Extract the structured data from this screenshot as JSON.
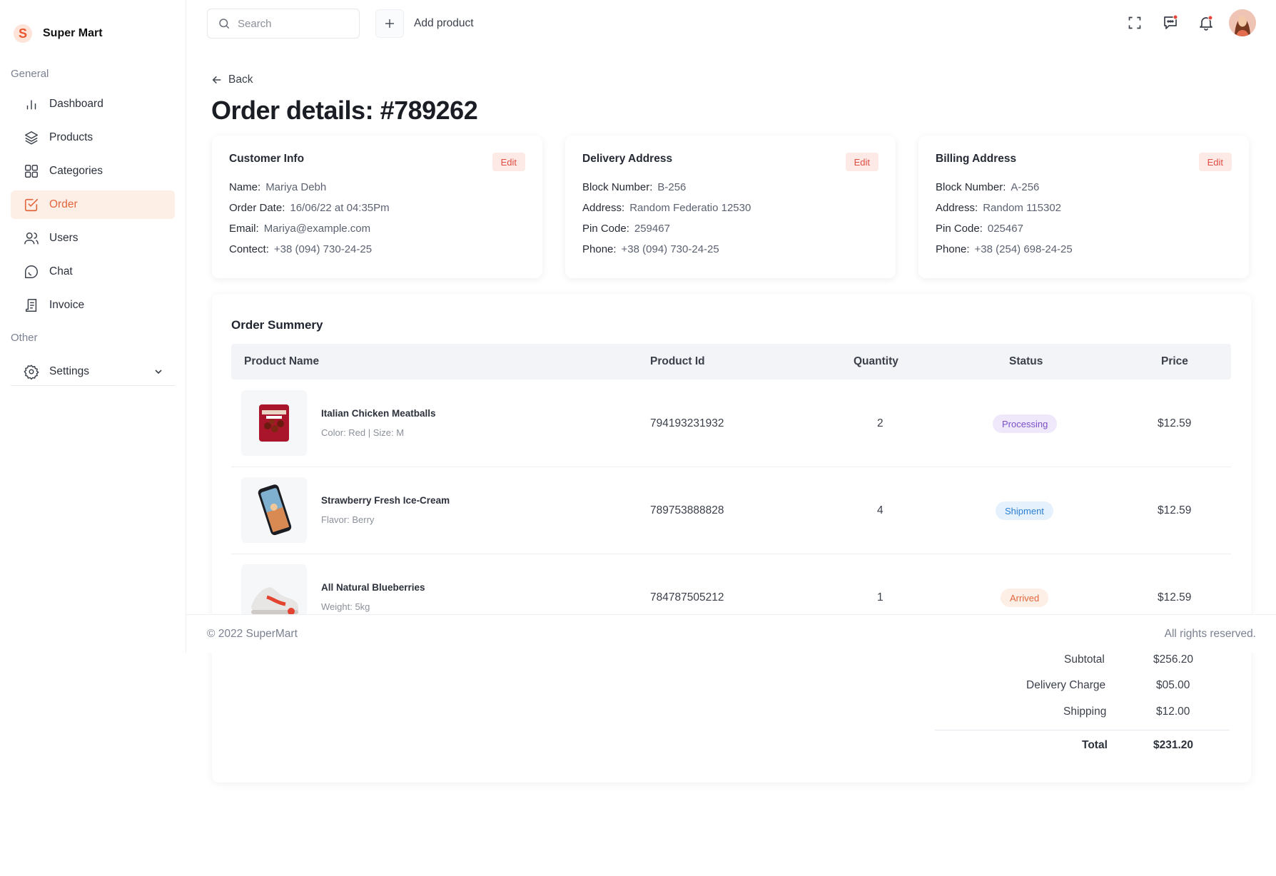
{
  "app": {
    "name": "Super Mart",
    "logo_letter": "S",
    "accent": "#e2673d"
  },
  "sidebar": {
    "sections": [
      {
        "label": "General"
      },
      {
        "label": "Other"
      }
    ],
    "items": [
      {
        "label": "Dashboard",
        "icon": "bar-chart-icon"
      },
      {
        "label": "Products",
        "icon": "layers-icon"
      },
      {
        "label": "Categories",
        "icon": "grid-icon"
      },
      {
        "label": "Order",
        "icon": "checkbox-icon",
        "active": true
      },
      {
        "label": "Users",
        "icon": "users-icon"
      },
      {
        "label": "Chat",
        "icon": "chat-icon"
      },
      {
        "label": "Invoice",
        "icon": "receipt-icon"
      },
      {
        "label": "Settings",
        "icon": "gear-icon"
      }
    ]
  },
  "topbar": {
    "search_placeholder": "Search",
    "add_product_label": "Add product"
  },
  "page": {
    "back_label": "Back",
    "title": "Order details: #789262"
  },
  "cards": [
    {
      "title": "Customer Info",
      "edit_label": "Edit",
      "rows": [
        {
          "k": "Name:",
          "v": "Mariya Debh"
        },
        {
          "k": "Order Date:",
          "v": "16/06/22 at 04:35Pm"
        },
        {
          "k": "Email:",
          "v": "Mariya@example.com"
        },
        {
          "k": "Contect:",
          "v": "+38 (094) 730-24-25"
        }
      ]
    },
    {
      "title": "Delivery Address",
      "edit_label": "Edit",
      "rows": [
        {
          "k": "Block Number:",
          "v": "B-256"
        },
        {
          "k": "Address:",
          "v": "Random Federatio 12530"
        },
        {
          "k": "Pin Code:",
          "v": "259467"
        },
        {
          "k": "Phone:",
          "v": "+38 (094) 730-24-25"
        }
      ]
    },
    {
      "title": "Billing Address",
      "edit_label": "Edit",
      "rows": [
        {
          "k": "Block Number:",
          "v": "A-256"
        },
        {
          "k": "Address:",
          "v": "Random 115302"
        },
        {
          "k": "Pin Code:",
          "v": "025467"
        },
        {
          "k": "Phone:",
          "v": "+38 (254) 698-24-25"
        }
      ]
    }
  ],
  "summary": {
    "title": "Order Summery",
    "columns": [
      "Product Name",
      "Product Id",
      "Quantity",
      "Status",
      "Price"
    ],
    "rows": [
      {
        "name": "Italian Chicken Meatballs",
        "meta": "Color: Red | Size: M",
        "id": "794193231932",
        "qty": "2",
        "status": "Processing",
        "price": "$12.59",
        "thumb": "meatballs-package"
      },
      {
        "name": "Strawberry Fresh Ice-Cream",
        "meta": "Flavor: Berry",
        "id": "789753888828",
        "qty": "4",
        "status": "Shipment",
        "price": "$12.59",
        "thumb": "smartphone"
      },
      {
        "name": "All Natural Blueberries",
        "meta": "Weight: 5kg",
        "id": "784787505212",
        "qty": "1",
        "status": "Arrived",
        "price": "$12.59",
        "thumb": "sneaker"
      }
    ],
    "status_colors": {
      "Processing": "#7a4fc7",
      "Shipment": "#2a7fd4",
      "Arrived": "#e2673d"
    },
    "totals": [
      {
        "label": "Subtotal",
        "value": "$256.20"
      },
      {
        "label": "Delivery Charge",
        "value": "$05.00"
      },
      {
        "label": "Shipping",
        "value": "$12.00"
      },
      {
        "label": "Total",
        "value": "$231.20"
      }
    ]
  },
  "footer": {
    "copyright": "© 2022 SuperMart",
    "rights": "All rights reserved."
  }
}
